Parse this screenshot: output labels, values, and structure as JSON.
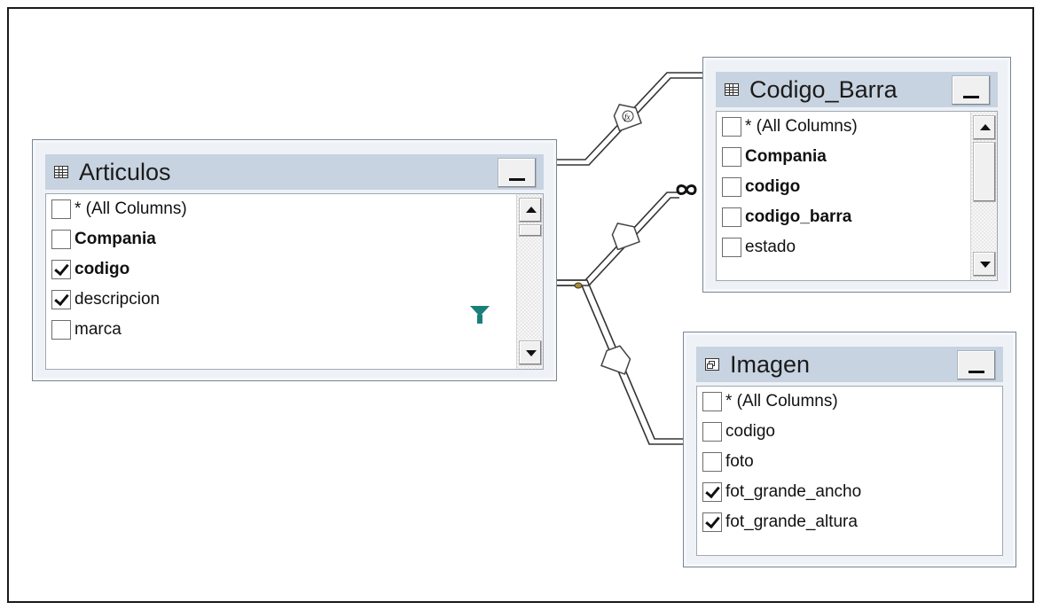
{
  "tables": {
    "articulos": {
      "title": "Articulos",
      "icon": "table-icon",
      "columns": [
        {
          "label": "* (All Columns)",
          "checked": false,
          "key": false
        },
        {
          "label": "Compania",
          "checked": false,
          "key": true
        },
        {
          "label": "codigo",
          "checked": true,
          "key": true
        },
        {
          "label": "descripcion",
          "checked": true,
          "key": false,
          "filter": true
        },
        {
          "label": "marca",
          "checked": false,
          "key": false
        }
      ]
    },
    "codigo_barra": {
      "title": "Codigo_Barra",
      "icon": "table-icon",
      "columns": [
        {
          "label": "* (All Columns)",
          "checked": false,
          "key": false
        },
        {
          "label": "Compania",
          "checked": false,
          "key": true
        },
        {
          "label": "codigo",
          "checked": false,
          "key": true
        },
        {
          "label": "codigo_barra",
          "checked": false,
          "key": true
        },
        {
          "label": "estado",
          "checked": false,
          "key": false
        }
      ]
    },
    "imagen": {
      "title": "Imagen",
      "icon": "view-icon",
      "columns": [
        {
          "label": "* (All Columns)",
          "checked": false,
          "key": false
        },
        {
          "label": "codigo",
          "checked": false,
          "key": false
        },
        {
          "label": "foto",
          "checked": false,
          "key": false
        },
        {
          "label": "fot_grande_ancho",
          "checked": true,
          "key": false
        },
        {
          "label": "fot_grande_altura",
          "checked": true,
          "key": false
        }
      ]
    }
  },
  "joins": [
    {
      "from": "Articulos",
      "to": "Codigo_Barra",
      "marker": "function-icon"
    },
    {
      "from": "Articulos",
      "to": "Codigo_Barra",
      "marker": "infinity-icon"
    },
    {
      "from": "Articulos",
      "to": "Imagen",
      "marker": "join-diamond-icon"
    }
  ],
  "colors": {
    "title_bar": "#c8d3e1",
    "window_bg": "#eef2f7",
    "filter_icon": "#1a7f79"
  }
}
